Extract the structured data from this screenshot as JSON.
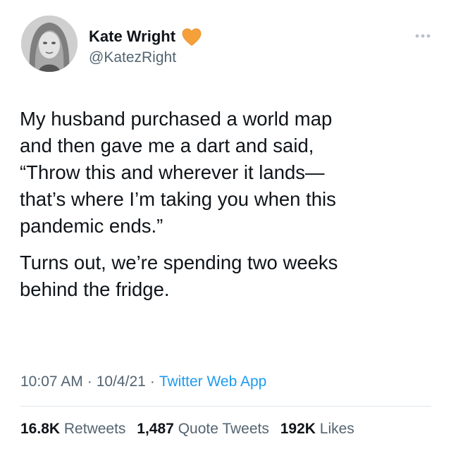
{
  "author": {
    "display_name": "Kate Wright",
    "handle": "@KatezRight",
    "badge_icon": "orange-heart-icon",
    "badge_color": "#f6a03a"
  },
  "more_icon": "ellipsis-icon",
  "tweet": {
    "paragraph_1": "My husband purchased a world map\nand then gave me a dart and said,\n“Throw this and wherever it lands—\nthat’s where I’m taking you when this\npandemic ends.”",
    "paragraph_2": "Turns out, we’re spending two weeks\nbehind the fridge."
  },
  "meta": {
    "time": "10:07 AM",
    "separator": "·",
    "date": "10/4/21",
    "source": "Twitter Web App"
  },
  "stats": {
    "retweets_count": "16.8K",
    "retweets_label": "Retweets",
    "quote_tweets_count": "1,487",
    "quote_tweets_label": "Quote Tweets",
    "likes_count": "192K",
    "likes_label": "Likes"
  },
  "colors": {
    "text": "#0f1419",
    "secondary": "#536471",
    "link": "#1d9bf0",
    "divider": "#e1e6ea"
  }
}
